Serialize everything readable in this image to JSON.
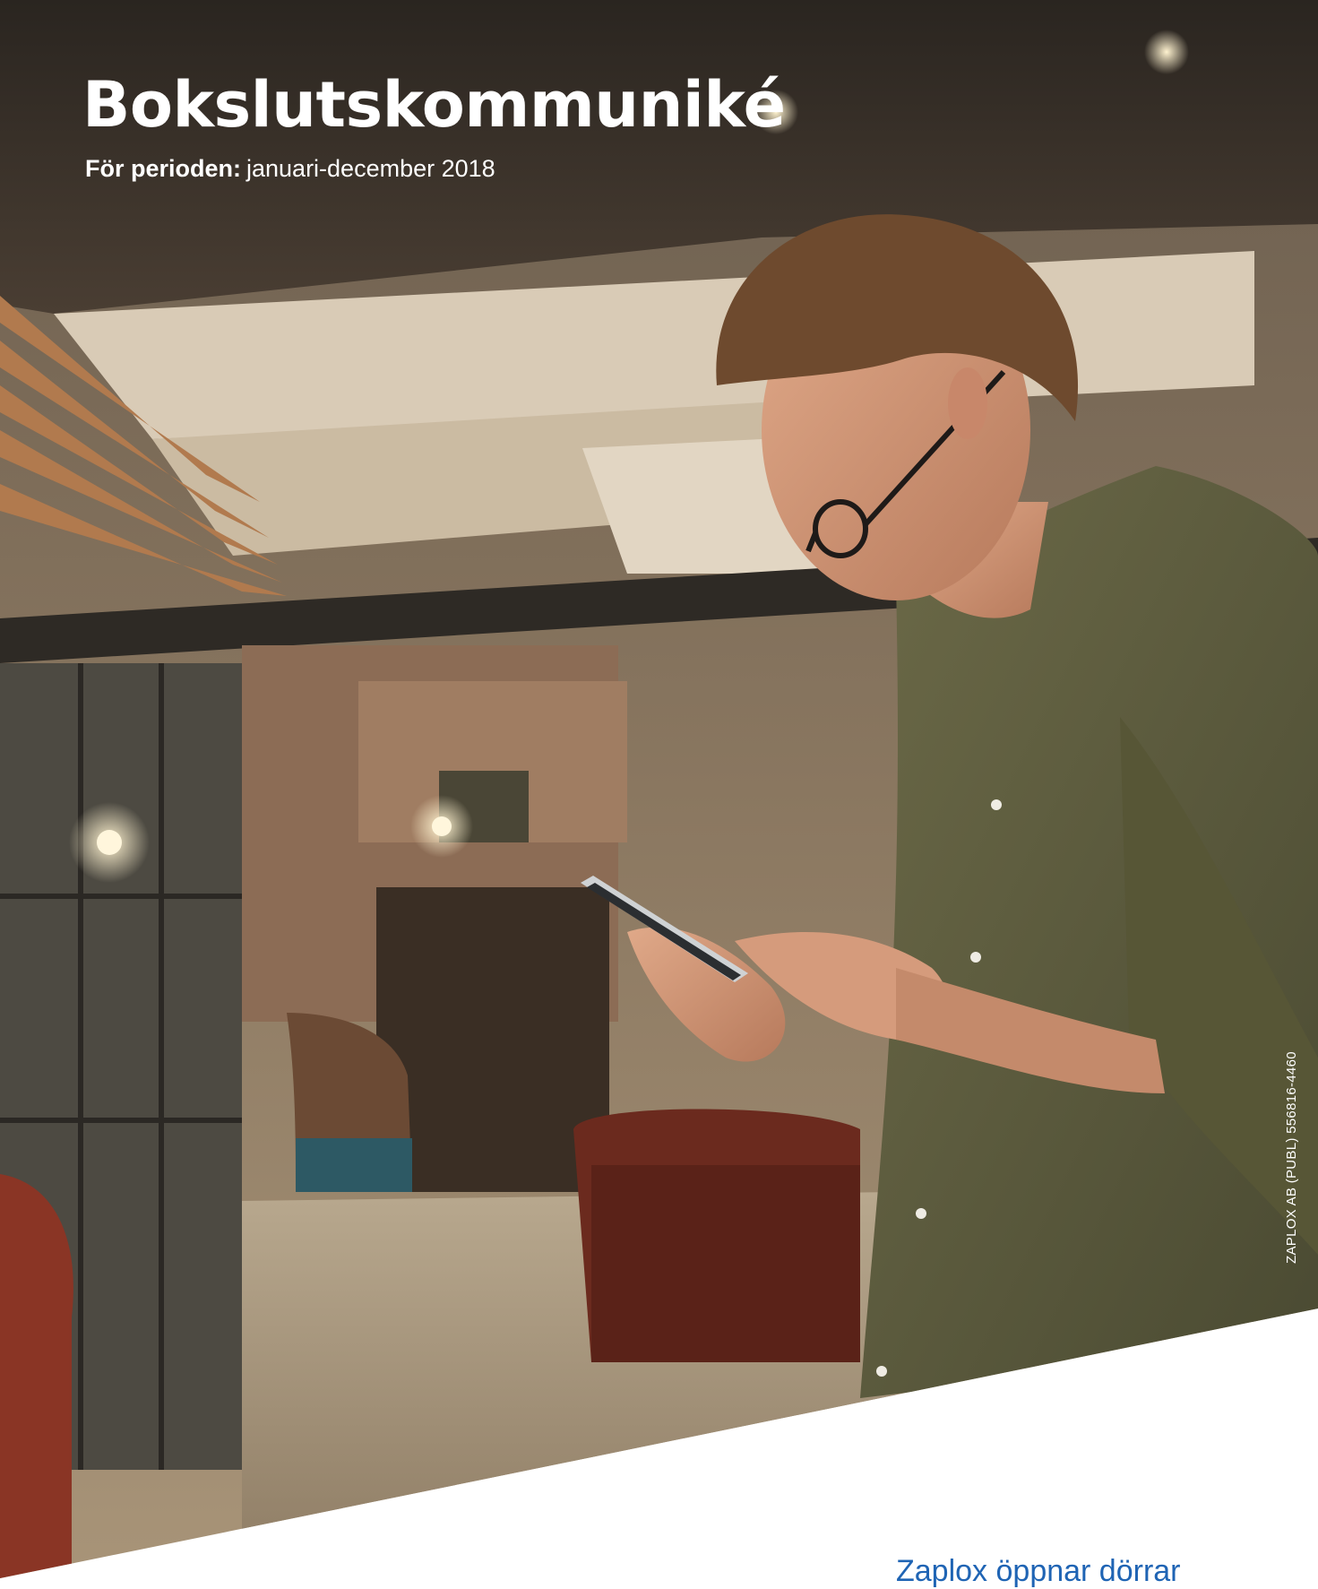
{
  "cover": {
    "title": "Bokslutskommuniké",
    "period_label": "För perioden:",
    "period_value": "januari-december 2018",
    "vertical_company_id": "ZAPLOX AB (PUBL) 556816-4460",
    "tagline": "Zaplox öppnar dörrar"
  },
  "colors": {
    "tagline_blue": "#1f64b4",
    "title_white": "#ffffff",
    "shirt_olive": "#5b5a3c"
  },
  "photo": {
    "icon": "man-using-smartphone-in-lounge-photo"
  }
}
